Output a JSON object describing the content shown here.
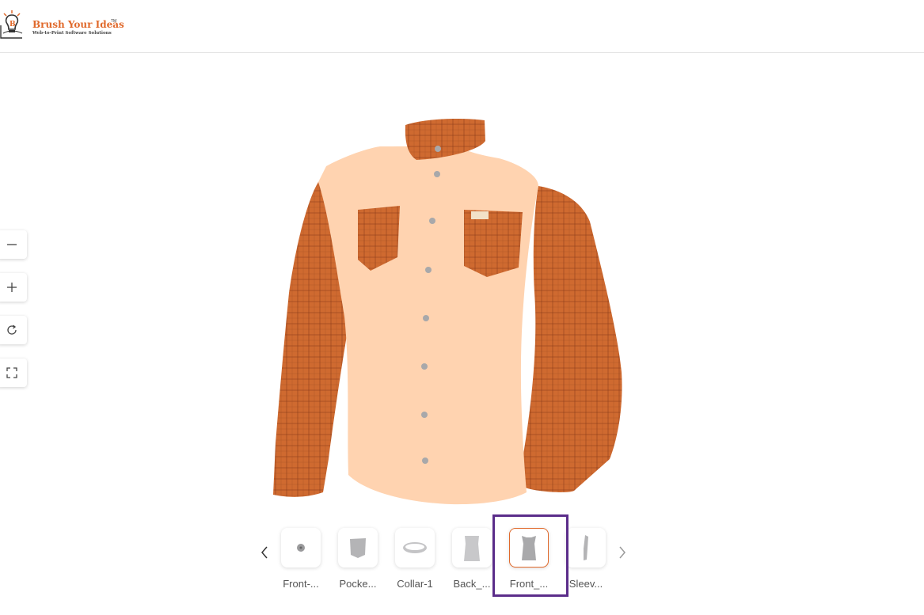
{
  "brand": {
    "name": "Brush Your Ideas",
    "trademark": "TM",
    "tagline": "Web-to-Print Software Solutions",
    "accent_color": "#e0692b"
  },
  "tools": [
    {
      "name": "zoom-out",
      "icon": "minus-icon"
    },
    {
      "name": "zoom-in",
      "icon": "plus-icon"
    },
    {
      "name": "reset-rotation",
      "icon": "rotate-icon"
    },
    {
      "name": "fullscreen",
      "icon": "fullscreen-icon"
    }
  ],
  "viewer": {
    "model": "shirt",
    "body_color": "#ffd3b0",
    "plaid_color": "#cf6a30"
  },
  "carousel": {
    "prev_icon": "chevron-left-icon",
    "next_icon": "chevron-right-icon",
    "items": [
      {
        "label": "Front-...",
        "icon": "button-icon"
      },
      {
        "label": "Pocke...",
        "icon": "pocket-icon"
      },
      {
        "label": "Collar-1",
        "icon": "collar-icon"
      },
      {
        "label": "Back_...",
        "icon": "back-panel-icon"
      },
      {
        "label": "Front_...",
        "icon": "front-panel-icon",
        "selected": true
      },
      {
        "label": "Sleev...",
        "icon": "sleeve-icon"
      }
    ],
    "highlight_color": "#5b2d8a"
  }
}
